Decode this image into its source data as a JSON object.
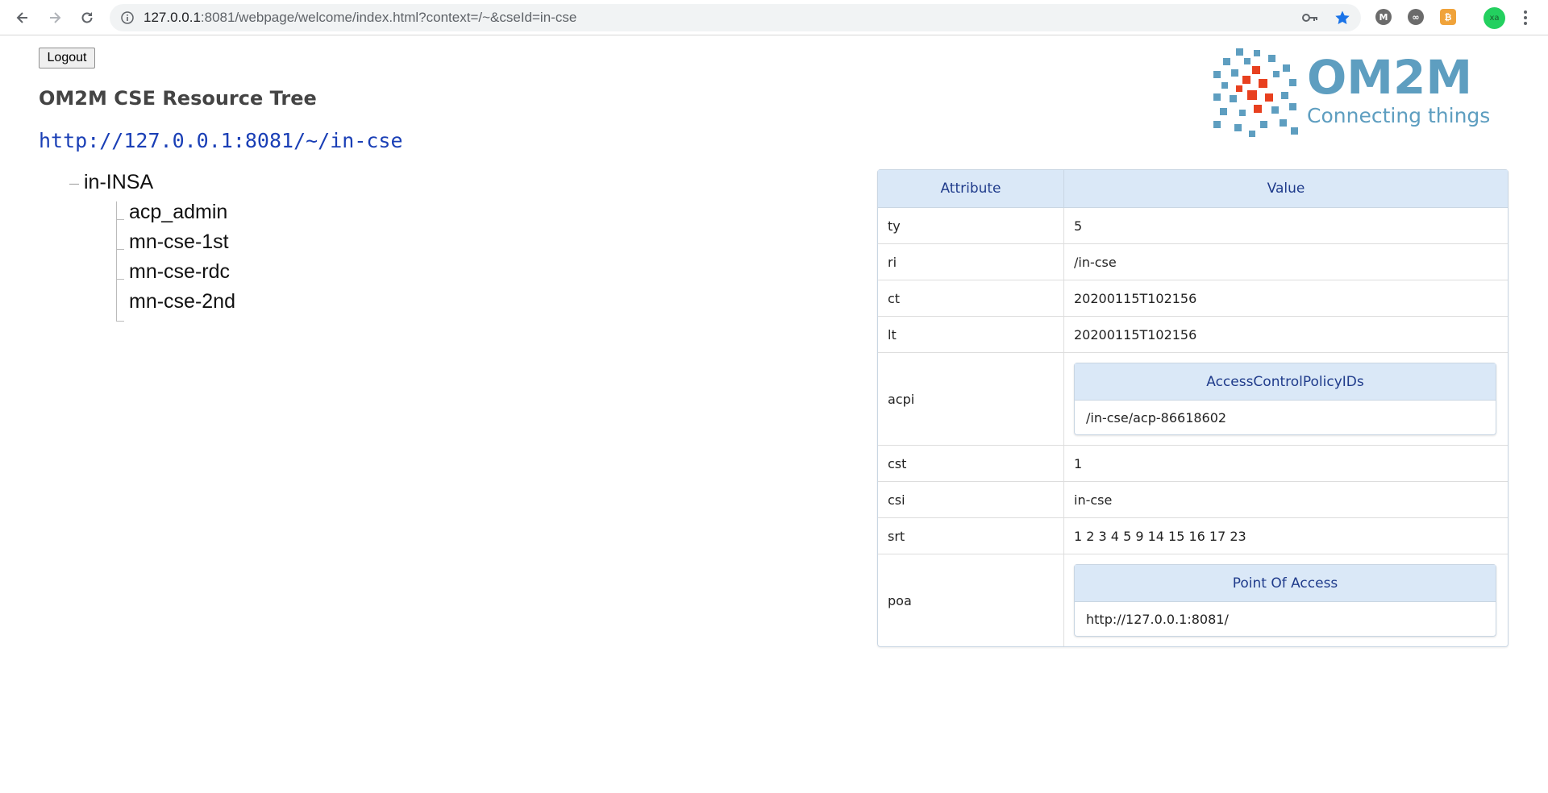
{
  "browser": {
    "url_host": "127.0.0.1",
    "url_rest": ":8081/webpage/welcome/index.html?context=/~&cseId=in-cse",
    "profile_initials": "xa",
    "extensions": [
      "m-extension-icon",
      "link-extension-icon",
      "bitcoin-extension-icon"
    ]
  },
  "page": {
    "logout_label": "Logout",
    "title": "OM2M CSE Resource Tree",
    "base_url": "http://127.0.0.1:8081/~/in-cse"
  },
  "logo": {
    "title": "OM2M",
    "subtitle": "Connecting things"
  },
  "tree": {
    "root": "in-INSA",
    "children": [
      "acp_admin",
      "mn-cse-1st",
      "mn-cse-rdc",
      "mn-cse-2nd"
    ]
  },
  "table": {
    "headers": {
      "attribute": "Attribute",
      "value": "Value"
    },
    "rows": {
      "ty": {
        "key": "ty",
        "value": "5"
      },
      "ri": {
        "key": "ri",
        "value": "/in-cse"
      },
      "ct": {
        "key": "ct",
        "value": "20200115T102156"
      },
      "lt": {
        "key": "lt",
        "value": "20200115T102156"
      },
      "acpi": {
        "key": "acpi",
        "sub_header": "AccessControlPolicyIDs",
        "sub_value": "/in-cse/acp-86618602"
      },
      "cst": {
        "key": "cst",
        "value": "1"
      },
      "csi": {
        "key": "csi",
        "value": "in-cse"
      },
      "srt": {
        "key": "srt",
        "value": "1 2 3 4 5 9 14 15 16 17 23"
      },
      "poa": {
        "key": "poa",
        "sub_header": "Point Of Access",
        "sub_value": "http://127.0.0.1:8081/"
      }
    }
  },
  "colors": {
    "link": "#1a3fb6",
    "table_header_bg": "#dae8f7",
    "table_header_text": "#1f3b8b",
    "logo_blue": "#5e9ec0",
    "logo_red": "#e8401f"
  }
}
